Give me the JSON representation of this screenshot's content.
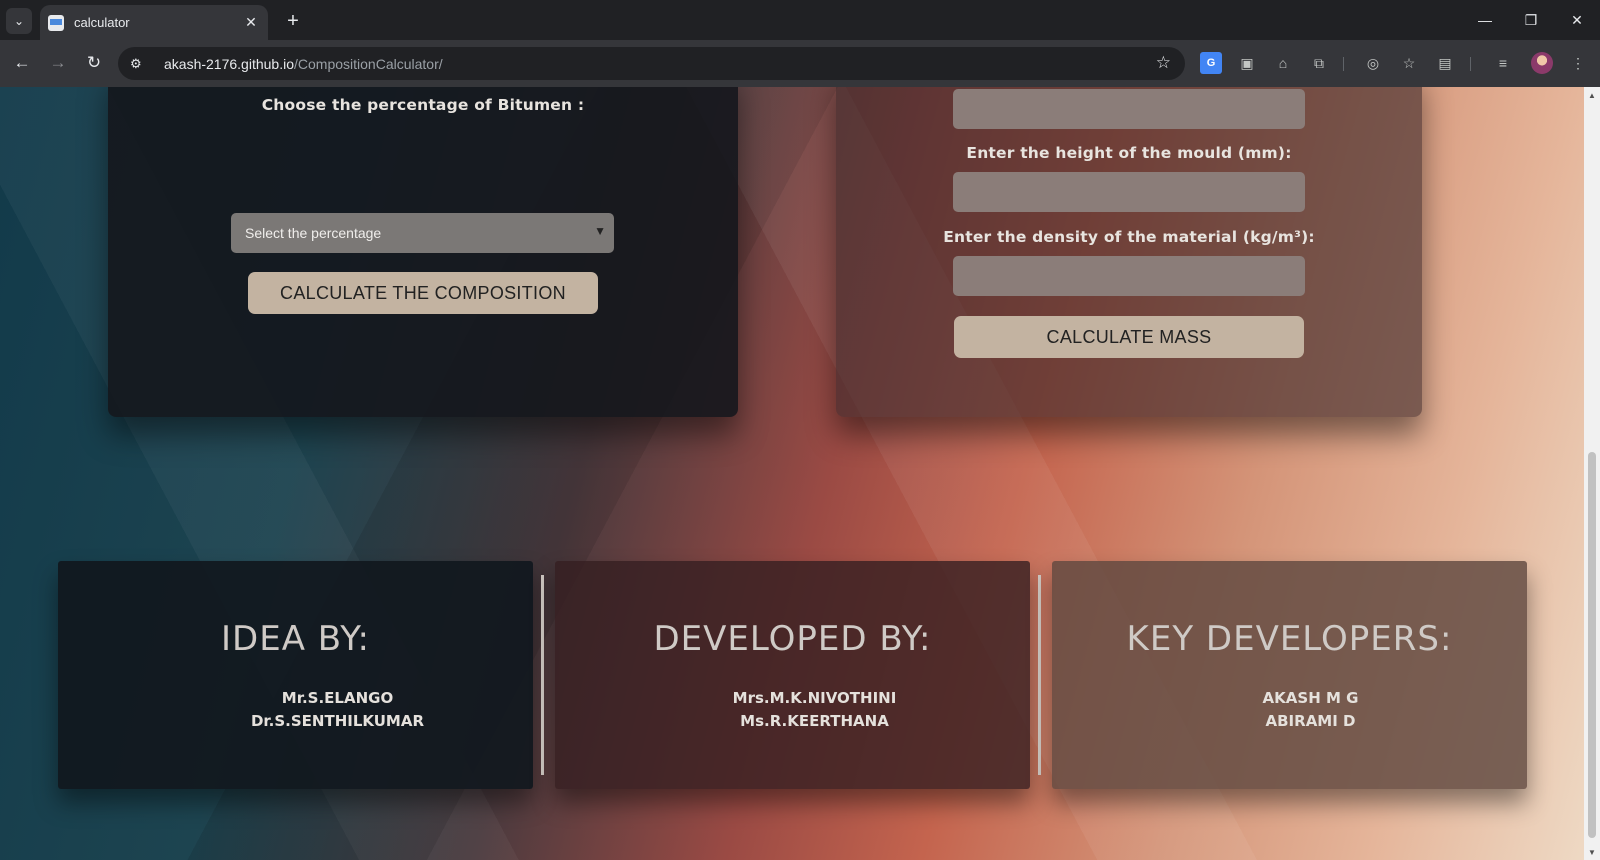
{
  "browser": {
    "tab_title": "calculator",
    "url_host": "akash-2176.github.io",
    "url_path": "/CompositionCalculator/"
  },
  "composition_panel": {
    "bitumen_label": "Choose the percentage of Bitumen :",
    "percentage_select_value": "Select the percentage",
    "calculate_button": "CALCULATE THE COMPOSITION"
  },
  "mass_panel": {
    "height_label": "Enter the height of the mould (mm):",
    "density_label": "Enter the density of the material (kg/m³):",
    "calculate_button": "CALCULATE MASS"
  },
  "credits": [
    {
      "title": "IDEA BY:",
      "names": [
        "Mr.S.ELANGO",
        "Dr.S.SENTHILKUMAR"
      ]
    },
    {
      "title": "DEVELOPED BY:",
      "names": [
        "Mrs.M.K.NIVOTHINI",
        "Ms.R.KEERTHANA"
      ]
    },
    {
      "title": "KEY DEVELOPERS:",
      "names": [
        "AKASH M G",
        "ABIRAMI D"
      ]
    }
  ],
  "colors": {
    "button_bg": "#c3b3a1",
    "input_bg": "#8b7d79",
    "select_bg": "#7b7876"
  }
}
